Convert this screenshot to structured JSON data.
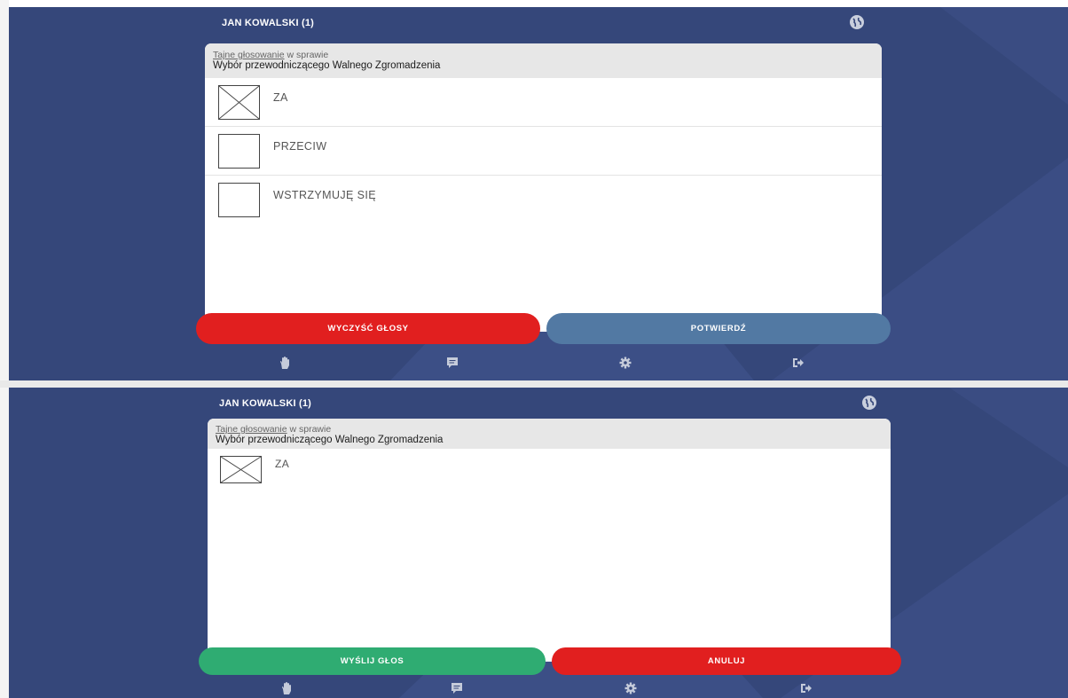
{
  "colors": {
    "background": "#35477a",
    "card": "#ffffff",
    "card_header": "#e7e7e7",
    "danger": "#e11f1f",
    "confirm": "#5279a3",
    "success": "#2fac72"
  },
  "screen1": {
    "user_name": "JAN KOWALSKI (1)",
    "globe_icon": "globe-icon",
    "header": {
      "vote_type_link": "Tajne głosowanie",
      "vote_type_suffix": " w sprawie",
      "subject": "Wybór przewodniczącego Walnego Zgromadzenia"
    },
    "options": [
      {
        "label": "ZA",
        "checked": true
      },
      {
        "label": "PRZECIW",
        "checked": false
      },
      {
        "label": "WSTRZYMUJĘ SIĘ",
        "checked": false
      }
    ],
    "buttons": {
      "clear_votes": "WYCZYŚĆ GŁOSY",
      "confirm": "POTWIERDŹ"
    },
    "nav_icons": [
      "hand-icon",
      "chat-icon",
      "gear-icon",
      "logout-icon"
    ]
  },
  "screen2": {
    "user_name": "JAN KOWALSKI (1)",
    "globe_icon": "globe-icon",
    "header": {
      "vote_type_link": "Tajne głosowanie",
      "vote_type_suffix": " w sprawie",
      "subject": "Wybór przewodniczącego Walnego Zgromadzenia"
    },
    "options": [
      {
        "label": "ZA",
        "checked": true
      }
    ],
    "buttons": {
      "send_vote": "WYŚLIJ GŁOS",
      "cancel": "ANULUJ"
    },
    "nav_icons": [
      "hand-icon",
      "chat-icon",
      "gear-icon",
      "logout-icon"
    ]
  }
}
